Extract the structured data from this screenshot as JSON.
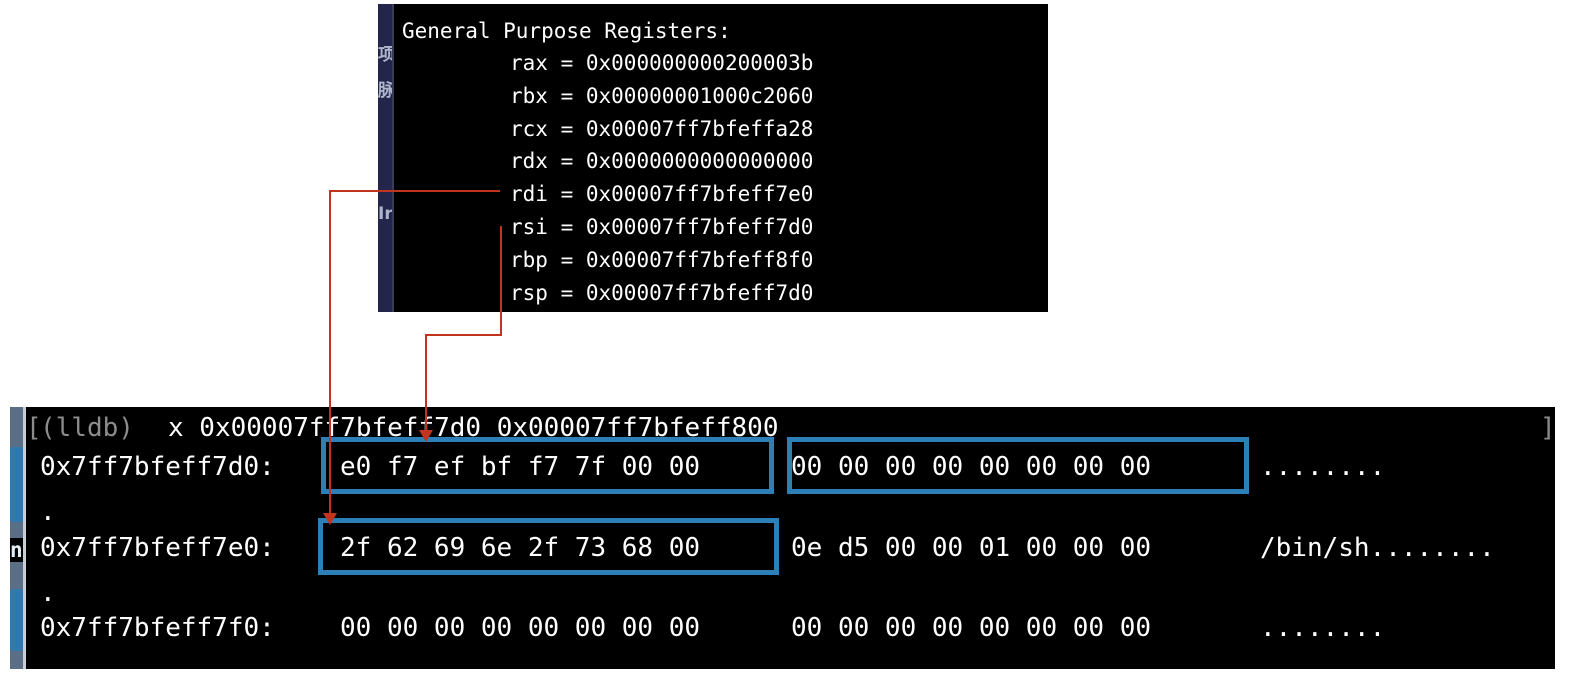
{
  "registers": {
    "title": "General Purpose Registers:",
    "rows": [
      {
        "name": "rax",
        "value": "0x000000000200003b"
      },
      {
        "name": "rbx",
        "value": "0x00000001000c2060"
      },
      {
        "name": "rcx",
        "value": "0x00007ff7bfeffa28"
      },
      {
        "name": "rdx",
        "value": "0x0000000000000000"
      },
      {
        "name": "rdi",
        "value": "0x00007ff7bfeff7e0"
      },
      {
        "name": "rsi",
        "value": "0x00007ff7bfeff7d0"
      },
      {
        "name": "rbp",
        "value": "0x00007ff7bfeff8f0"
      },
      {
        "name": "rsp",
        "value": "0x00007ff7bfeff7d0"
      }
    ]
  },
  "terminal": {
    "bracket_open": "[",
    "prompt": "(lldb)",
    "command": "x 0x00007ff7bfeff7d0 0x00007ff7bfeff800",
    "bracket_close": "]",
    "rows": [
      {
        "address": "0x7ff7bfeff7d0:",
        "bytes_group1": "e0 f7 ef bf f7 7f 00 00",
        "bytes_group2": "00 00 00 00 00 00 00 00",
        "ascii": "........",
        "wrap": "."
      },
      {
        "address": "0x7ff7bfeff7e0:",
        "bytes_group1": "2f 62 69 6e 2f 73 68 00",
        "bytes_group2": "0e d5 00 00 01 00 00 00",
        "ascii": "/bin/sh........",
        "wrap": "."
      },
      {
        "address": "0x7ff7bfeff7f0:",
        "bytes_group1": "00 00 00 00 00 00 00 00",
        "bytes_group2": "00 00 00 00 00 00 00 00",
        "ascii": "........"
      }
    ]
  },
  "sidebar_fragments": {
    "reg_strip_glyphs": [
      "项",
      "脉",
      "Ir"
    ],
    "terminal_left_glyph": "n"
  },
  "colors": {
    "highlight_box": "#2d7fb8",
    "arrow": "#c1341d",
    "prompt": "#8c8c8c"
  }
}
